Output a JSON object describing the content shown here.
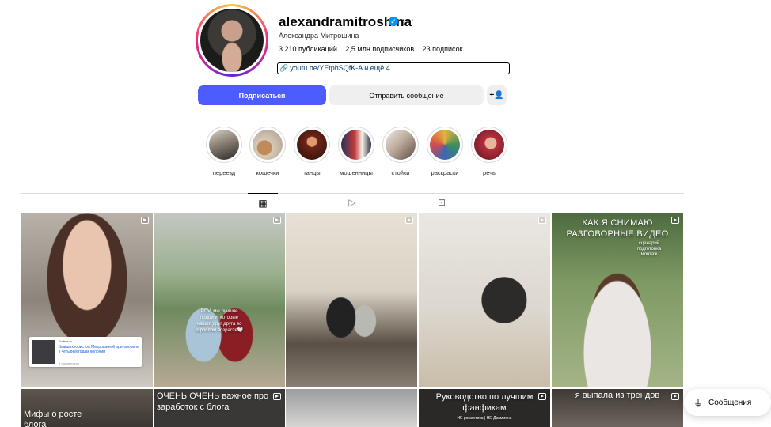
{
  "profile": {
    "username": "alexandramitroshina",
    "full_name": "Александра Митрошина",
    "stats": {
      "posts": "3 210 публикаций",
      "followers": "2,5 млн подписчиков",
      "following": "23 подписок"
    },
    "link": "youtu.be/YEtphSQfK-A и ещё 4"
  },
  "buttons": {
    "follow": "Подписаться",
    "message": "Отправить сообщение",
    "add_user": "+👤"
  },
  "highlights": [
    {
      "label": "переезд"
    },
    {
      "label": "кошечки"
    },
    {
      "label": "танцы"
    },
    {
      "label": "мошенницы"
    },
    {
      "label": "стойки"
    },
    {
      "label": "раскраски"
    },
    {
      "label": "речь"
    }
  ],
  "tabs": [
    {
      "icon": "grid-icon",
      "glyph": "▦"
    },
    {
      "icon": "reels-icon",
      "glyph": "▷"
    },
    {
      "icon": "tagged-icon",
      "glyph": "⊡"
    }
  ],
  "posts": {
    "p1": {
      "news_source": "Forbes.ru",
      "news_title": "Бывших юристов Митрошиной приговорили к четырем годам колонии",
      "news_time": "8 часов назад"
    },
    "p2": {
      "overlay": "POV: мы лучшие подруги, которые нашли друг друга во взрослом возрасте🤍"
    },
    "p5": {
      "title": "КАК Я СНИМАЮ РАЗГОВОРНЫЕ ВИДЕО",
      "subtitle": "сценарий подготовка монтаж"
    },
    "p6": {
      "title": "Мифы о росте блога"
    },
    "p7": {
      "title": "ОЧЕНЬ ОЧЕНЬ важное про заработок с блога"
    },
    "p9": {
      "title": "Руководство по лучшим фанфикам",
      "subtitle": "НЕ романтика | НЕ Драмиона"
    },
    "p10": {
      "title": "я выпала из трендов"
    }
  },
  "messages_pill": {
    "label": "Сообщения"
  },
  "colors": {
    "follow_button": "#4c5cff",
    "secondary_button": "#efefef",
    "verified": "#0095f6",
    "link": "#00376b"
  }
}
